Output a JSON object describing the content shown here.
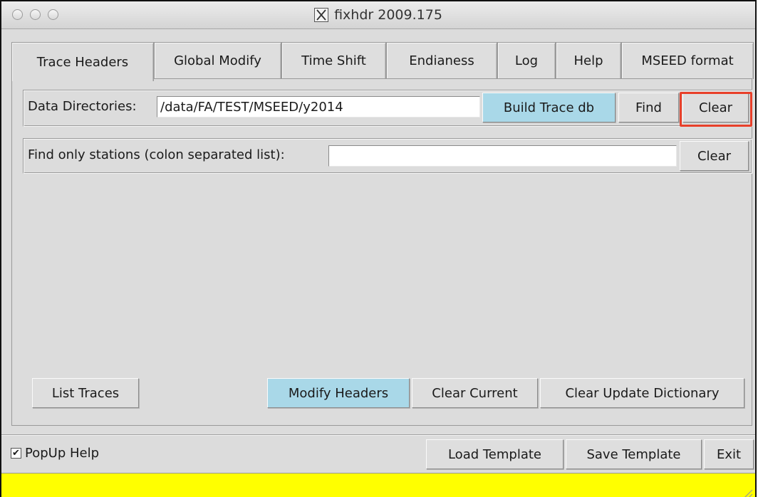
{
  "window": {
    "title": "fixhdr 2009.175",
    "status_bar_color": "#ffff00"
  },
  "tabs": [
    {
      "label": "Trace Headers",
      "active": true
    },
    {
      "label": "Global Modify"
    },
    {
      "label": "Time Shift"
    },
    {
      "label": "Endianess"
    },
    {
      "label": "Log"
    },
    {
      "label": "Help"
    },
    {
      "label": "MSEED format"
    }
  ],
  "data_dirs": {
    "label": "Data Directories:",
    "value": "/data/FA/TEST/MSEED/y2014",
    "build_label": "Build Trace db",
    "find_label": "Find",
    "clear_label": "Clear"
  },
  "stations": {
    "label": "Find only stations (colon separated list):",
    "value": "",
    "clear_label": "Clear"
  },
  "actions": {
    "list_traces": "List Traces",
    "modify_headers": "Modify Headers",
    "clear_current": "Clear Current",
    "clear_update_dict": "Clear Update Dictionary"
  },
  "footer": {
    "popup_help_label": "PopUp Help",
    "popup_help_checked": true,
    "load_template": "Load Template",
    "save_template": "Save Template",
    "exit": "Exit"
  },
  "colors": {
    "accent_button": "#a9d8e8",
    "highlight": "#e8402a",
    "background": "#dcdcdc"
  }
}
